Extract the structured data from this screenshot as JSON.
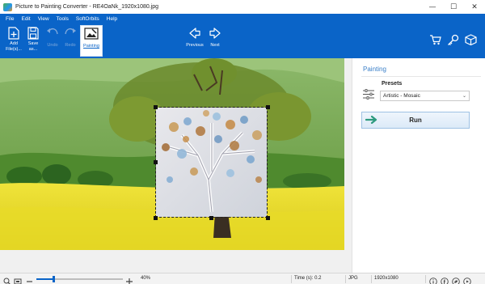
{
  "window": {
    "title": "Picture to Painting Converter - RE4OaNk_1920x1080.jpg",
    "controls": [
      "—",
      "☐",
      "✕"
    ]
  },
  "menu": [
    "File",
    "Edit",
    "View",
    "Tools",
    "SoftOrbits",
    "Help"
  ],
  "ribbon": {
    "add_files": "Add\nFile(s)...",
    "save_as": "Save\nas...",
    "undo": "Undo",
    "redo": "Redo",
    "painting": "Painting",
    "previous": "Previous",
    "next": "Next",
    "right_icons": [
      "cart-icon",
      "key-icon",
      "box-icon"
    ]
  },
  "panel": {
    "title": "Painting",
    "presets_label": "Presets",
    "preset_value": "Artistic - Mosaic",
    "run_label": "Run"
  },
  "status": {
    "zoom_percent": "40%",
    "zoom_level": 0.2,
    "time": "Time (s): 0.2",
    "format": "JPG",
    "dimensions": "1920x1080",
    "social_icons": [
      "info-icon",
      "facebook-icon",
      "twitter-icon",
      "youtube-icon"
    ]
  },
  "colors": {
    "accent": "#0a64c8",
    "panel_title": "#3a7fc8",
    "run_arrow": "#2d9a7e"
  }
}
